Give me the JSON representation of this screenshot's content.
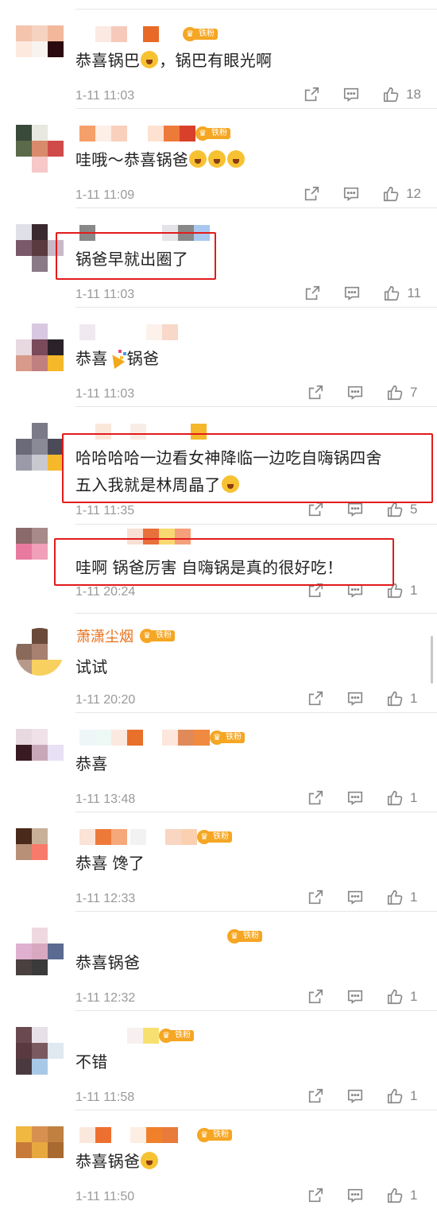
{
  "badge_label": "铁粉",
  "comments": [
    {
      "name": "",
      "text": "恭喜锅巴",
      "text_after": "，锅巴有眼光啊",
      "time": "1-11 11:03",
      "likes": "18"
    },
    {
      "name": "",
      "text": "哇哦～恭喜锅爸",
      "time": "1-11 11:09",
      "likes": "12"
    },
    {
      "name": "",
      "text": "锅爸早就出圈了",
      "time": "1-11 11:03",
      "likes": "11"
    },
    {
      "name": "",
      "text": "恭喜",
      "text_after": "锅爸",
      "time": "1-11 11:03",
      "likes": "7"
    },
    {
      "name": "",
      "text": "哈哈哈哈一边看女神降临一边吃自嗨锅四舍",
      "text_line2": "五入我就是林周晶了",
      "time": "1-11 11:35",
      "likes": "5"
    },
    {
      "name": "",
      "text": "哇啊 锅爸厉害 自嗨锅是真的很好吃！",
      "time": "1-11 20:24",
      "likes": "1"
    },
    {
      "name": "萧潇尘烟",
      "text": "试试",
      "time": "1-11 20:20",
      "likes": "1"
    },
    {
      "name": "",
      "text": "恭喜",
      "time": "1-11 13:48",
      "likes": "1"
    },
    {
      "name": "",
      "text": "恭喜 馋了",
      "time": "1-11 12:33",
      "likes": "1"
    },
    {
      "name": "",
      "text": "恭喜锅爸",
      "time": "1-11 12:32",
      "likes": "1"
    },
    {
      "name": "",
      "text": "不错",
      "time": "1-11 11:58",
      "likes": "1"
    },
    {
      "name": "",
      "text": "恭喜锅爸",
      "time": "1-11 11:50",
      "likes": "1"
    }
  ],
  "colors": {
    "highlight": "#e21b1b",
    "badge": "#f5a623",
    "name": "#e8701a",
    "meta": "#999999"
  }
}
